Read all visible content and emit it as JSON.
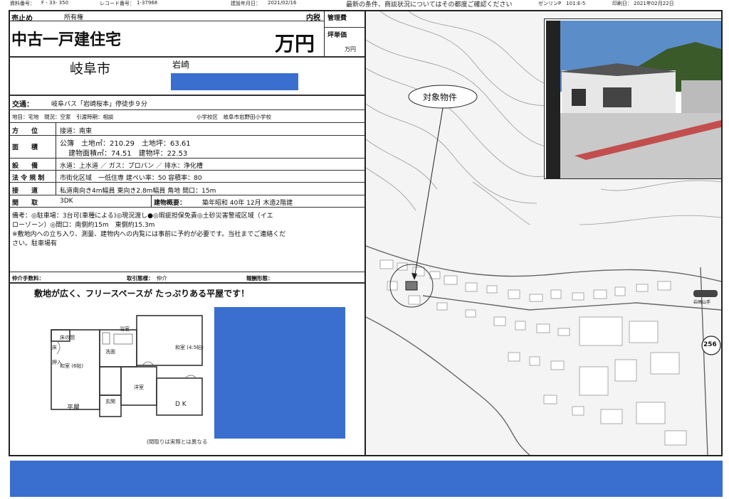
{
  "header": {
    "doc_no_label": "資料番号：",
    "doc_no": "F - 33- 350",
    "record_label": "レコード番号：",
    "record_no": "1-37968",
    "registered_label": "建設年月日：",
    "registered_date": "2021/02/16",
    "notice": "最新の条件、商談状況についてはその都度ご確認ください",
    "zenrin": "ゼンリンP　101:E-5",
    "print_label": "印刷日：",
    "print_date": "2021年02月22日"
  },
  "listing": {
    "status": "売止め",
    "ownership": "所有権",
    "tax": "内税",
    "type": "中古一戸建住宅",
    "price_unit": "万円",
    "mgmt_fee": "管理費",
    "tsubo_price": "坪単価",
    "tsubo_unit": "万円",
    "city": "岐阜市",
    "district": "岩崎"
  },
  "details": {
    "transport_label": "交通：",
    "transport": "岐阜バス「岩崎桜本」停徒歩９分",
    "land_info": "地目：宅地　現況：空家　引渡時期：相談",
    "school": "小学校区　岐阜市岩野田小学校",
    "direction_label": "方　　位",
    "direction": "接道：南東",
    "area_label": "面　　積",
    "area_line1": "公簿　土地㎡：210.29　土地坪：63.61",
    "area_line2": "建物面積㎡：74.51　建物坪：22.53",
    "facility_label": "設　　備",
    "facility": "水道：上水道 ／ ガス：プロパン ／ 排水：浄化槽",
    "law_label": "法 令 規 制",
    "law": "市街化区域　一低住専 建ぺい率：50 容積率：80",
    "road_label": "接　　道",
    "road": "私道南向き4m幅員 東向き2.8m幅員 角地 間口：15m",
    "layout_label": "間　　取",
    "layout": "3DK",
    "building_label": "建物概要：",
    "building": "築年昭和 40年 12月 木造2階建",
    "remarks": [
      "備考：◎駐車場：3台可(車種による)◎現況渡し●◎瑕疵担保免責◎土砂災害警戒区域（イエ",
      "ローゾーン）◎間口：南側約15m　東側約15.3m",
      "※敷地内への立ち入り、測量、建物内への内覧には事前に予約が必要です。当社までご連絡くだ",
      "さい。駐車場有"
    ],
    "broker_fee": "仲介手数料：",
    "transaction_label": "取引態様：",
    "transaction": "仲介",
    "reward": "報酬形態："
  },
  "floorplan": {
    "headline": "敷地が広く、フリースペースが たっぷりある平屋です！",
    "rooms": [
      "床の間",
      "和室 (6帖)",
      "押入",
      "床",
      "浴室",
      "洗面",
      "和室 (4.5帖)",
      "洋室",
      "D K",
      "玄関"
    ],
    "caption": "平屋",
    "note": "(間取りは実際とは異なる"
  },
  "map": {
    "target_label": "対象物件",
    "route_no": "256",
    "bus_stop": "岩崎山手"
  }
}
